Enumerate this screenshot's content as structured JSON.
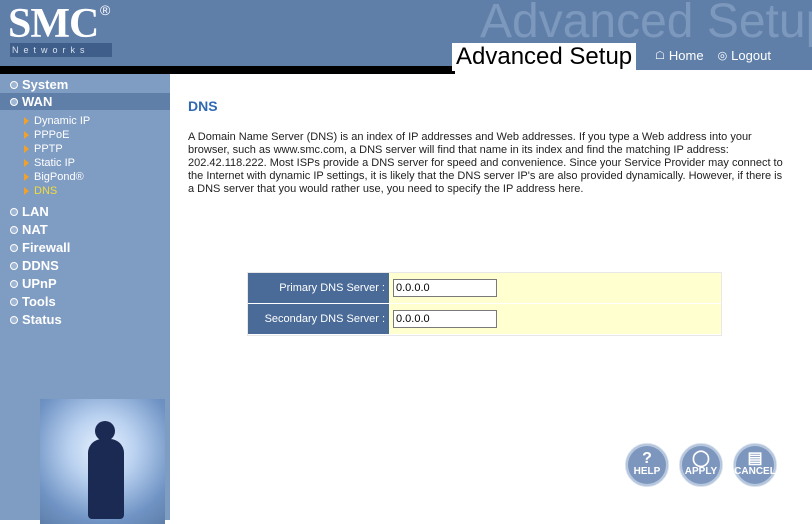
{
  "header": {
    "logo": "SMC",
    "logo_sub": "Networks",
    "reg": "®",
    "watermark": "Advanced Setup",
    "title": "Advanced Setup",
    "home": "Home",
    "logout": "Logout"
  },
  "sidebar": {
    "items": [
      {
        "label": "System"
      },
      {
        "label": "WAN"
      },
      {
        "label": "LAN"
      },
      {
        "label": "NAT"
      },
      {
        "label": "Firewall"
      },
      {
        "label": "DDNS"
      },
      {
        "label": "UPnP"
      },
      {
        "label": "Tools"
      },
      {
        "label": "Status"
      }
    ],
    "wan_sub": [
      {
        "label": "Dynamic IP"
      },
      {
        "label": "PPPoE"
      },
      {
        "label": "PPTP"
      },
      {
        "label": "Static IP"
      },
      {
        "label": "BigPond®"
      },
      {
        "label": "DNS"
      }
    ]
  },
  "main": {
    "title": "DNS",
    "description": "A Domain Name Server (DNS) is an index of IP addresses and Web addresses. If you type a Web address into your browser, such as www.smc.com, a DNS server will find that name in its index and find the matching IP address: 202.42.118.222. Most ISPs provide a DNS server for speed and convenience. Since your Service Provider may connect to the Internet with dynamic IP settings, it is likely that the DNS server IP's are also provided dynamically. However, if there is a DNS server that you would rather use, you need to specify the IP address here.",
    "primary_label": "Primary DNS Server :",
    "primary_value": "0.0.0.0",
    "secondary_label": "Secondary DNS Server :",
    "secondary_value": "0.0.0.0"
  },
  "buttons": {
    "help": "HELP",
    "apply": "APPLY",
    "cancel": "CANCEL"
  },
  "colors": {
    "header_bg": "#5f7fa9",
    "sidebar_bg": "#7f9cc2",
    "title_blue": "#2f6ab0",
    "label_bg": "#4a6b98",
    "field_bg": "#ffffd0"
  }
}
